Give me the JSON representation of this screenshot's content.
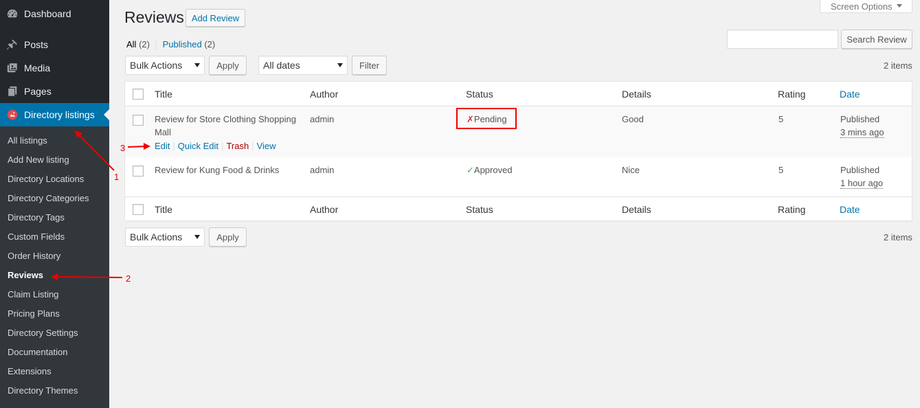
{
  "sidebar": {
    "top_items": [
      {
        "label": "Dashboard",
        "icon": "dashboard-icon"
      },
      {
        "label": "Posts",
        "icon": "pushpin-icon"
      },
      {
        "label": "Media",
        "icon": "media-icon"
      },
      {
        "label": "Pages",
        "icon": "pages-icon"
      },
      {
        "label": "Directory listings",
        "icon": "directory-listings-icon"
      }
    ],
    "submenu": [
      "All listings",
      "Add New listing",
      "Directory Locations",
      "Directory Categories",
      "Directory Tags",
      "Custom Fields",
      "Order History",
      "Reviews",
      "Claim Listing",
      "Pricing Plans",
      "Directory Settings",
      "Documentation",
      "Extensions",
      "Directory Themes"
    ]
  },
  "header": {
    "title": "Reviews",
    "add_button": "Add Review",
    "screen_options": "Screen Options"
  },
  "filters": {
    "all_label": "All",
    "all_count": "(2)",
    "separator": "|",
    "published_label": "Published",
    "published_count": "(2)",
    "bulk_actions": "Bulk Actions",
    "apply": "Apply",
    "all_dates": "All dates",
    "filter": "Filter",
    "search_button": "Search Review",
    "items_count": "2 items"
  },
  "table": {
    "columns": [
      "Title",
      "Author",
      "Status",
      "Details",
      "Rating",
      "Date"
    ],
    "rows": [
      {
        "title": "Review for Store Clothing Shopping Mall",
        "author": "admin",
        "status_icon": "✗",
        "status": "Pending",
        "details": "Good",
        "rating": "5",
        "date_status": "Published",
        "date_ago": "3 mins ago",
        "actions": [
          "Edit",
          "Quick Edit",
          "Trash",
          "View"
        ]
      },
      {
        "title": "Review for Kung Food & Drinks",
        "author": "admin",
        "status_icon": "✓",
        "status": "Approved",
        "details": "Nice",
        "rating": "5",
        "date_status": "Published",
        "date_ago": "1 hour ago"
      }
    ]
  },
  "annotations": [
    "1",
    "2",
    "3"
  ],
  "colors": {
    "sidebar_bg": "#23282d",
    "submenu_bg": "#32373c",
    "accent": "#0073aa",
    "annotation_red": "#e00000"
  }
}
